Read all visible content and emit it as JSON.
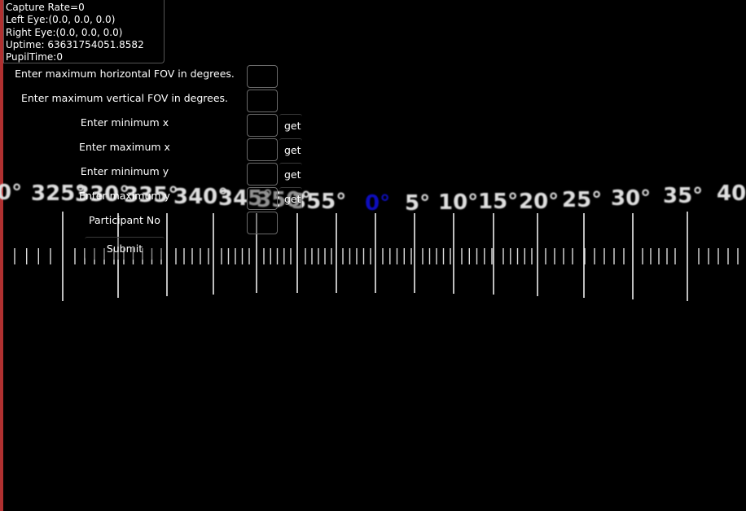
{
  "status": {
    "capture_rate": "Capture Rate=0",
    "left_eye": "Left Eye:(0.0, 0.0, 0.0)",
    "right_eye": "Right Eye:(0.0, 0.0, 0.0)",
    "uptime": "Uptime: 63631754051.8582",
    "pupil_time": "PupilTime:0"
  },
  "form": {
    "h_fov_label": "Enter maximum horizontal FOV in degrees.",
    "v_fov_label": "Enter maximum vertical FOV in degrees.",
    "min_x_label": "Enter minimum x",
    "max_x_label": "Enter maximum x",
    "min_y_label": "Enter minimum y",
    "max_y_label": "Enter maximum y",
    "participant_label": "Participant No",
    "get_label": "get",
    "submit_label": "Submit",
    "h_fov_value": "",
    "v_fov_value": "",
    "min_x_value": "",
    "max_x_value": "",
    "min_y_value": "",
    "max_y_value": "",
    "participant_value": ""
  },
  "ruler": {
    "labels": [
      "0°",
      "325°",
      "330°",
      "335°",
      "340°",
      "345°",
      "350°",
      "355°",
      "0°",
      "5°",
      "10°",
      "15°",
      "20°",
      "25°",
      "30°",
      "35°",
      "40"
    ],
    "center_label": "0°",
    "center_color": "#1010c0",
    "label_color": "#e0e0e0"
  },
  "colors": {
    "background": "#000000",
    "left_edge": "#b03030"
  }
}
